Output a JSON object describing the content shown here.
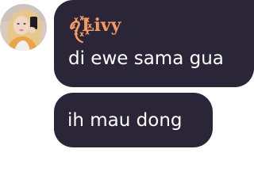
{
  "messages": [
    {
      "sender": "ꪖ꙰꙰Livy",
      "text": "di ewe sama gua"
    },
    {
      "text": "ih mau dong"
    }
  ],
  "colors": {
    "bubble": "#2b2538",
    "sender_name": "#f29a5f",
    "message_text": "#ffffff"
  },
  "avatar": {
    "icon": "profile-photo-avatar"
  }
}
